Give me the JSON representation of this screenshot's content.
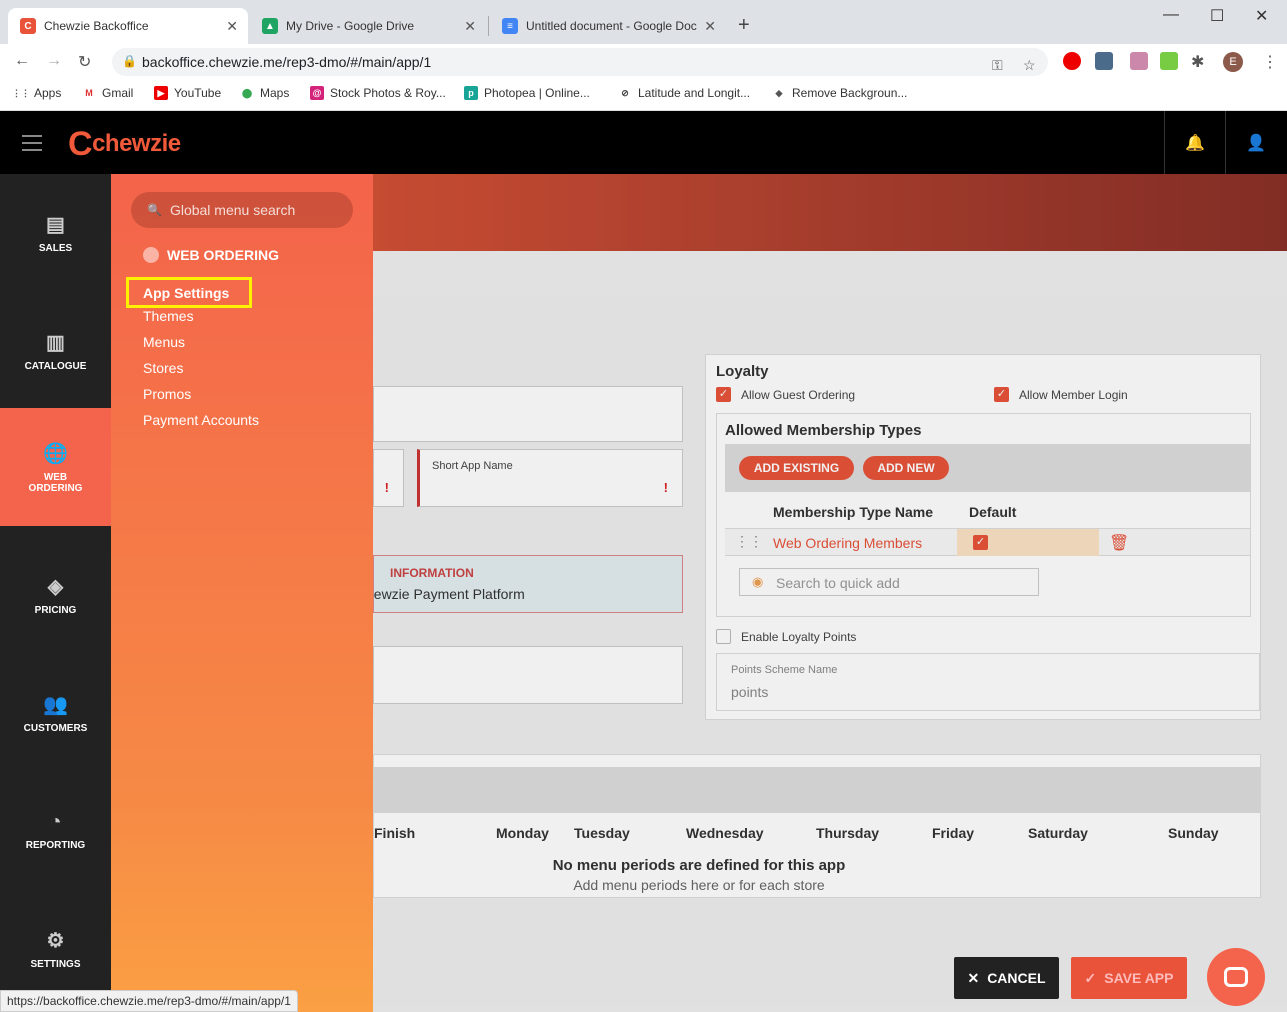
{
  "browser": {
    "tabs": [
      {
        "title": "Chewzie Backoffice"
      },
      {
        "title": "My Drive - Google Drive"
      },
      {
        "title": "Untitled document - Google Doc"
      }
    ],
    "url": "backoffice.chewzie.me/rep3-dmo/#/main/app/1",
    "profile_initial": "E",
    "bookmarks": [
      "Apps",
      "Gmail",
      "YouTube",
      "Maps",
      "Stock Photos & Roy...",
      "Photopea | Online...",
      "Latitude and Longit...",
      "Remove Backgroun..."
    ],
    "status_url": "https://backoffice.chewzie.me/rep3-dmo/#/main/app/1"
  },
  "header": {
    "logo": "chewzie"
  },
  "rail": {
    "items": [
      {
        "label": "SALES",
        "icon": "sales-icon"
      },
      {
        "label": "CATALOGUE",
        "icon": "catalogue-icon"
      },
      {
        "label": "WEB ORDERING",
        "icon": "globe-icon"
      },
      {
        "label": "PRICING",
        "icon": "pricing-icon"
      },
      {
        "label": "CUSTOMERS",
        "icon": "customers-icon"
      },
      {
        "label": "REPORTING",
        "icon": "pie-chart-icon"
      },
      {
        "label": "SETTINGS",
        "icon": "gear-icon"
      }
    ]
  },
  "flyout": {
    "search_placeholder": "Global menu search",
    "section": "WEB ORDERING",
    "items": [
      "App Settings",
      "Themes",
      "Menus",
      "Stores",
      "Promos",
      "Payment Accounts"
    ]
  },
  "main": {
    "short_app_name_label": "Short App Name",
    "info_title": "INFORMATION",
    "info_text": "hewzie Payment Platform",
    "loyalty": {
      "title": "Loyalty",
      "allow_guest": "Allow Guest Ordering",
      "allow_member": "Allow Member Login",
      "membership_title": "Allowed Membership Types",
      "add_existing": "ADD EXISTING",
      "add_new": "ADD NEW",
      "col_name": "Membership Type Name",
      "col_default": "Default",
      "row_name": "Web Ordering Members",
      "quick_add_placeholder": "Search to quick add",
      "enable_points": "Enable Loyalty Points",
      "points_label": "Points Scheme Name",
      "points_value": "points"
    },
    "periods": {
      "columns": [
        "Finish",
        "Monday",
        "Tuesday",
        "Wednesday",
        "Thursday",
        "Friday",
        "Saturday",
        "Sunday"
      ],
      "empty_title": "No menu periods are defined for this app",
      "empty_sub": "Add menu periods here or for each store"
    },
    "cancel": "CANCEL",
    "save": "SAVE APP"
  },
  "colors": {
    "accent": "#f4634b",
    "highlight": "#fff200"
  }
}
